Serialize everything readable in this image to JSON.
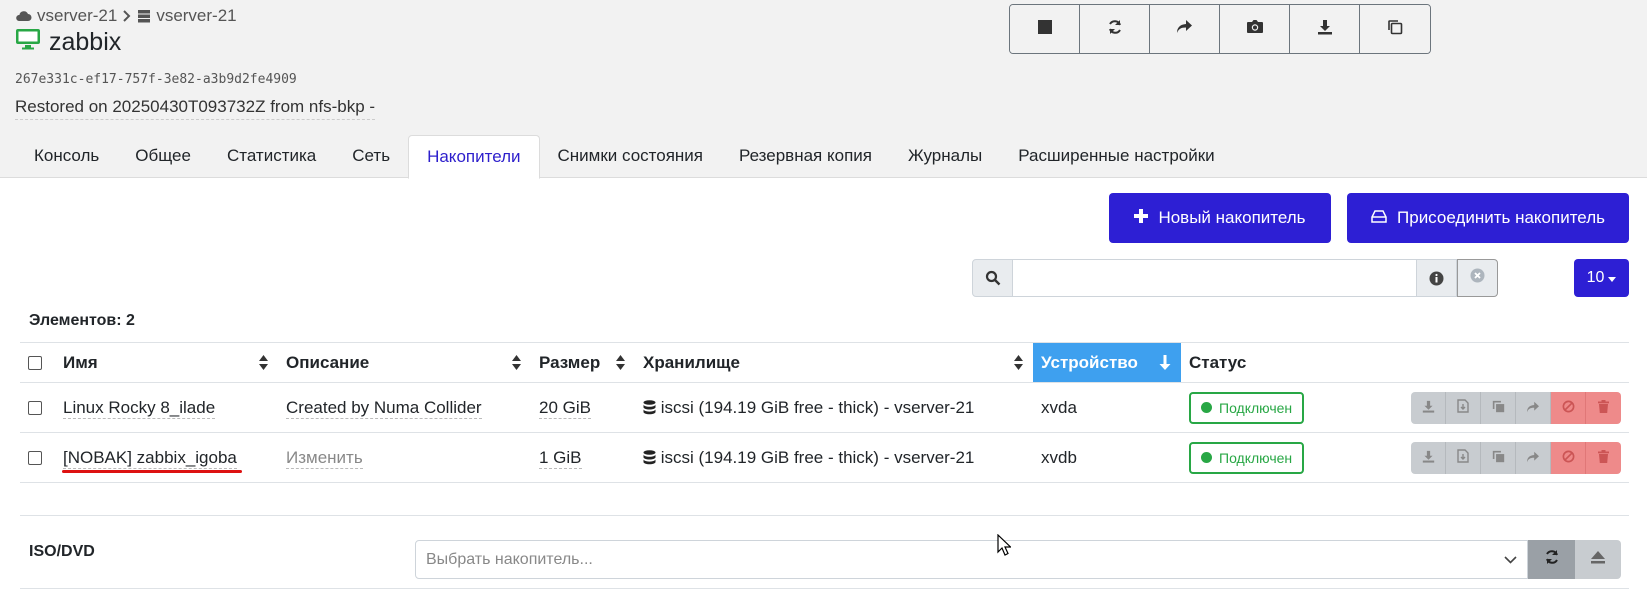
{
  "breadcrumb": {
    "cluster": "vserver-21",
    "host": "vserver-21"
  },
  "vm": {
    "name": "zabbix",
    "uuid": "267e331c-ef17-757f-3e82-a3b9d2fe4909",
    "description": "Restored on 20250430T093732Z from nfs-bkp -"
  },
  "toolbar": {
    "buttons": [
      "stop-icon",
      "refresh-icon",
      "share-icon",
      "camera-icon",
      "download-icon",
      "copy-icon"
    ]
  },
  "tabs": [
    {
      "label": "Консоль",
      "active": false
    },
    {
      "label": "Общее",
      "active": false
    },
    {
      "label": "Статистика",
      "active": false
    },
    {
      "label": "Сеть",
      "active": false
    },
    {
      "label": "Накопители",
      "active": true
    },
    {
      "label": "Снимки состояния",
      "active": false
    },
    {
      "label": "Резервная копия",
      "active": false
    },
    {
      "label": "Журналы",
      "active": false
    },
    {
      "label": "Расширенные настройки",
      "active": false
    }
  ],
  "actions": {
    "new_disk": "Новый накопитель",
    "attach_disk": "Присоединить накопитель"
  },
  "search": {
    "placeholder": "",
    "value": ""
  },
  "per_page": "10",
  "count_label": "Элементов: 2",
  "table": {
    "columns": [
      "Имя",
      "Описание",
      "Размер",
      "Хранилище",
      "Устройство",
      "Статус"
    ],
    "rows": [
      {
        "name": "Linux Rocky 8_ilade",
        "description": "Created by Numa Collider",
        "size": "20 GiB",
        "storage": "iscsi (194.19 GiB free - thick) - vserver-21",
        "device": "xvda",
        "status": "Подключен"
      },
      {
        "name": "[NOBAK] zabbix_igoba",
        "description": "Изменить",
        "size": "1 GiB",
        "storage": "iscsi (194.19 GiB free - thick) - vserver-21",
        "device": "xvdb",
        "status": "Подключен"
      }
    ]
  },
  "iso": {
    "label": "ISO/DVD",
    "placeholder": "Выбрать накопитель..."
  },
  "colors": {
    "primary": "#2d1fd4",
    "sorted_header": "#3ea0ef",
    "success": "#28a745",
    "danger": "#ee8a8a"
  }
}
